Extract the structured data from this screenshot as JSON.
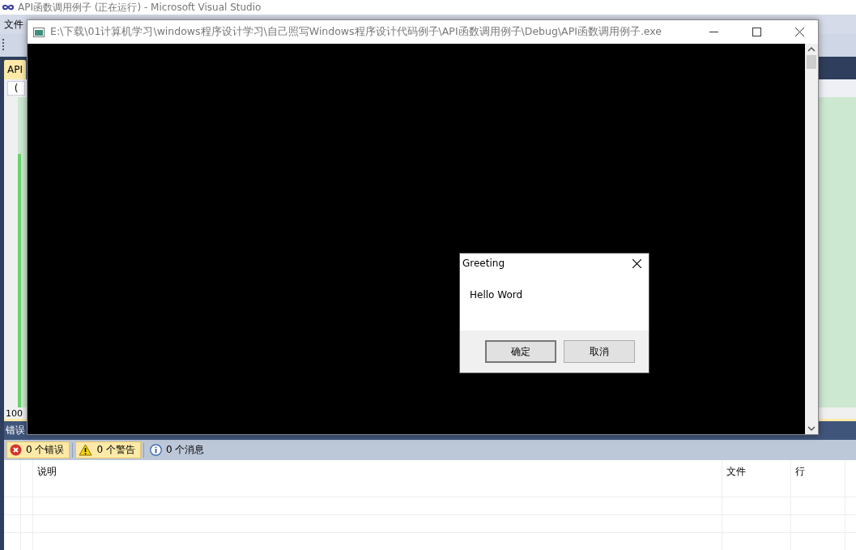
{
  "ide": {
    "title": "API函数调用例子 (正在运行) - Microsoft Visual Studio",
    "menu": [
      "文件"
    ],
    "doc_tab": {
      "label": "API",
      "selected": true
    },
    "nav_fragment": "(",
    "zoom": "100"
  },
  "error_list": {
    "title": "错误",
    "filters": [
      {
        "kind": "error",
        "label": "0 个错误",
        "selected": true
      },
      {
        "kind": "warning",
        "label": "0 个警告",
        "selected": true
      },
      {
        "kind": "info",
        "label": "0 个消息",
        "selected": false
      }
    ],
    "columns": [
      "说明",
      "文件",
      "行"
    ]
  },
  "console": {
    "title": "E:\\下载\\01计算机学习\\windows程序设计学习\\自己照写Windows程序设计代码例子\\API函数调用例子\\Debug\\API函数调用例子.exe"
  },
  "dialog": {
    "title": "Greeting",
    "message": "Hello Word",
    "buttons": [
      {
        "label": "确定",
        "default": true
      },
      {
        "label": "取消",
        "default": false
      }
    ]
  }
}
